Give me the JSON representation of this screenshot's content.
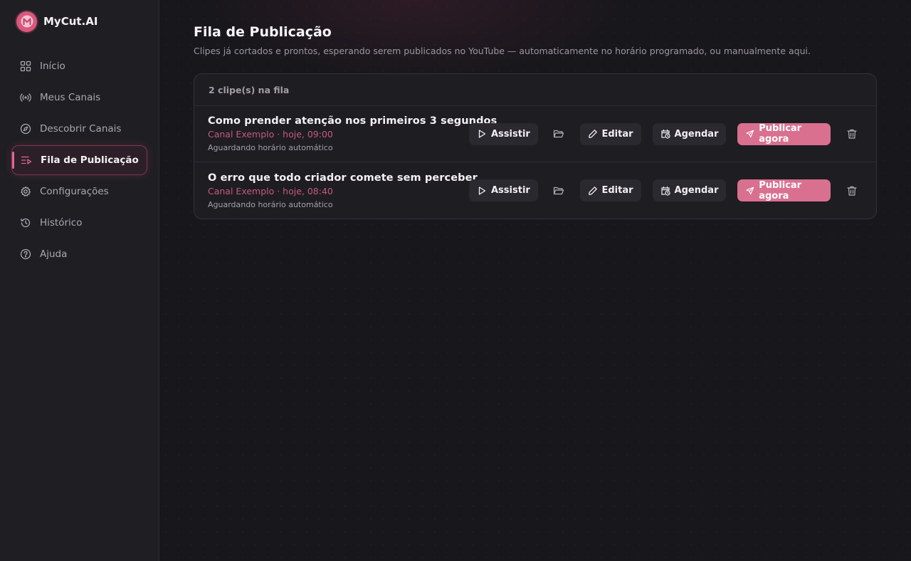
{
  "brand": {
    "name": "MyCut.AI",
    "logo_letter": "M",
    "accent": "#d9577d"
  },
  "sidebar": {
    "items": [
      {
        "label": "Início",
        "icon": "grid-icon",
        "active": false
      },
      {
        "label": "Meus Canais",
        "icon": "broadcast-icon",
        "active": false
      },
      {
        "label": "Descobrir Canais",
        "icon": "compass-icon",
        "active": false
      },
      {
        "label": "Fila de Publicação",
        "icon": "list-play-icon",
        "active": true
      },
      {
        "label": "Configurações",
        "icon": "gear-icon",
        "active": false
      },
      {
        "label": "Histórico",
        "icon": "history-icon",
        "active": false
      },
      {
        "label": "Ajuda",
        "icon": "help-circle-icon",
        "active": false
      }
    ]
  },
  "main": {
    "title": "Fila de Publicação",
    "subtitle": "Clipes já cortados e prontos, esperando serem publicados no YouTube — automaticamente no horário programado, ou manualmente aqui.",
    "queue": {
      "count_label": "2 clipe(s) na fila",
      "actions": {
        "watch": "Assistir",
        "edit": "Editar",
        "schedule": "Agendar",
        "publish": "Publicar agora"
      },
      "items": [
        {
          "title": "Como prender atenção nos primeiros 3 segundos",
          "meta": "Canal Exemplo · hoje, 09:00",
          "status": "Aguardando horário automático"
        },
        {
          "title": "O erro que todo criador comete sem perceber",
          "meta": "Canal Exemplo · hoje, 08:40",
          "status": "Aguardando horário automático"
        }
      ]
    }
  }
}
